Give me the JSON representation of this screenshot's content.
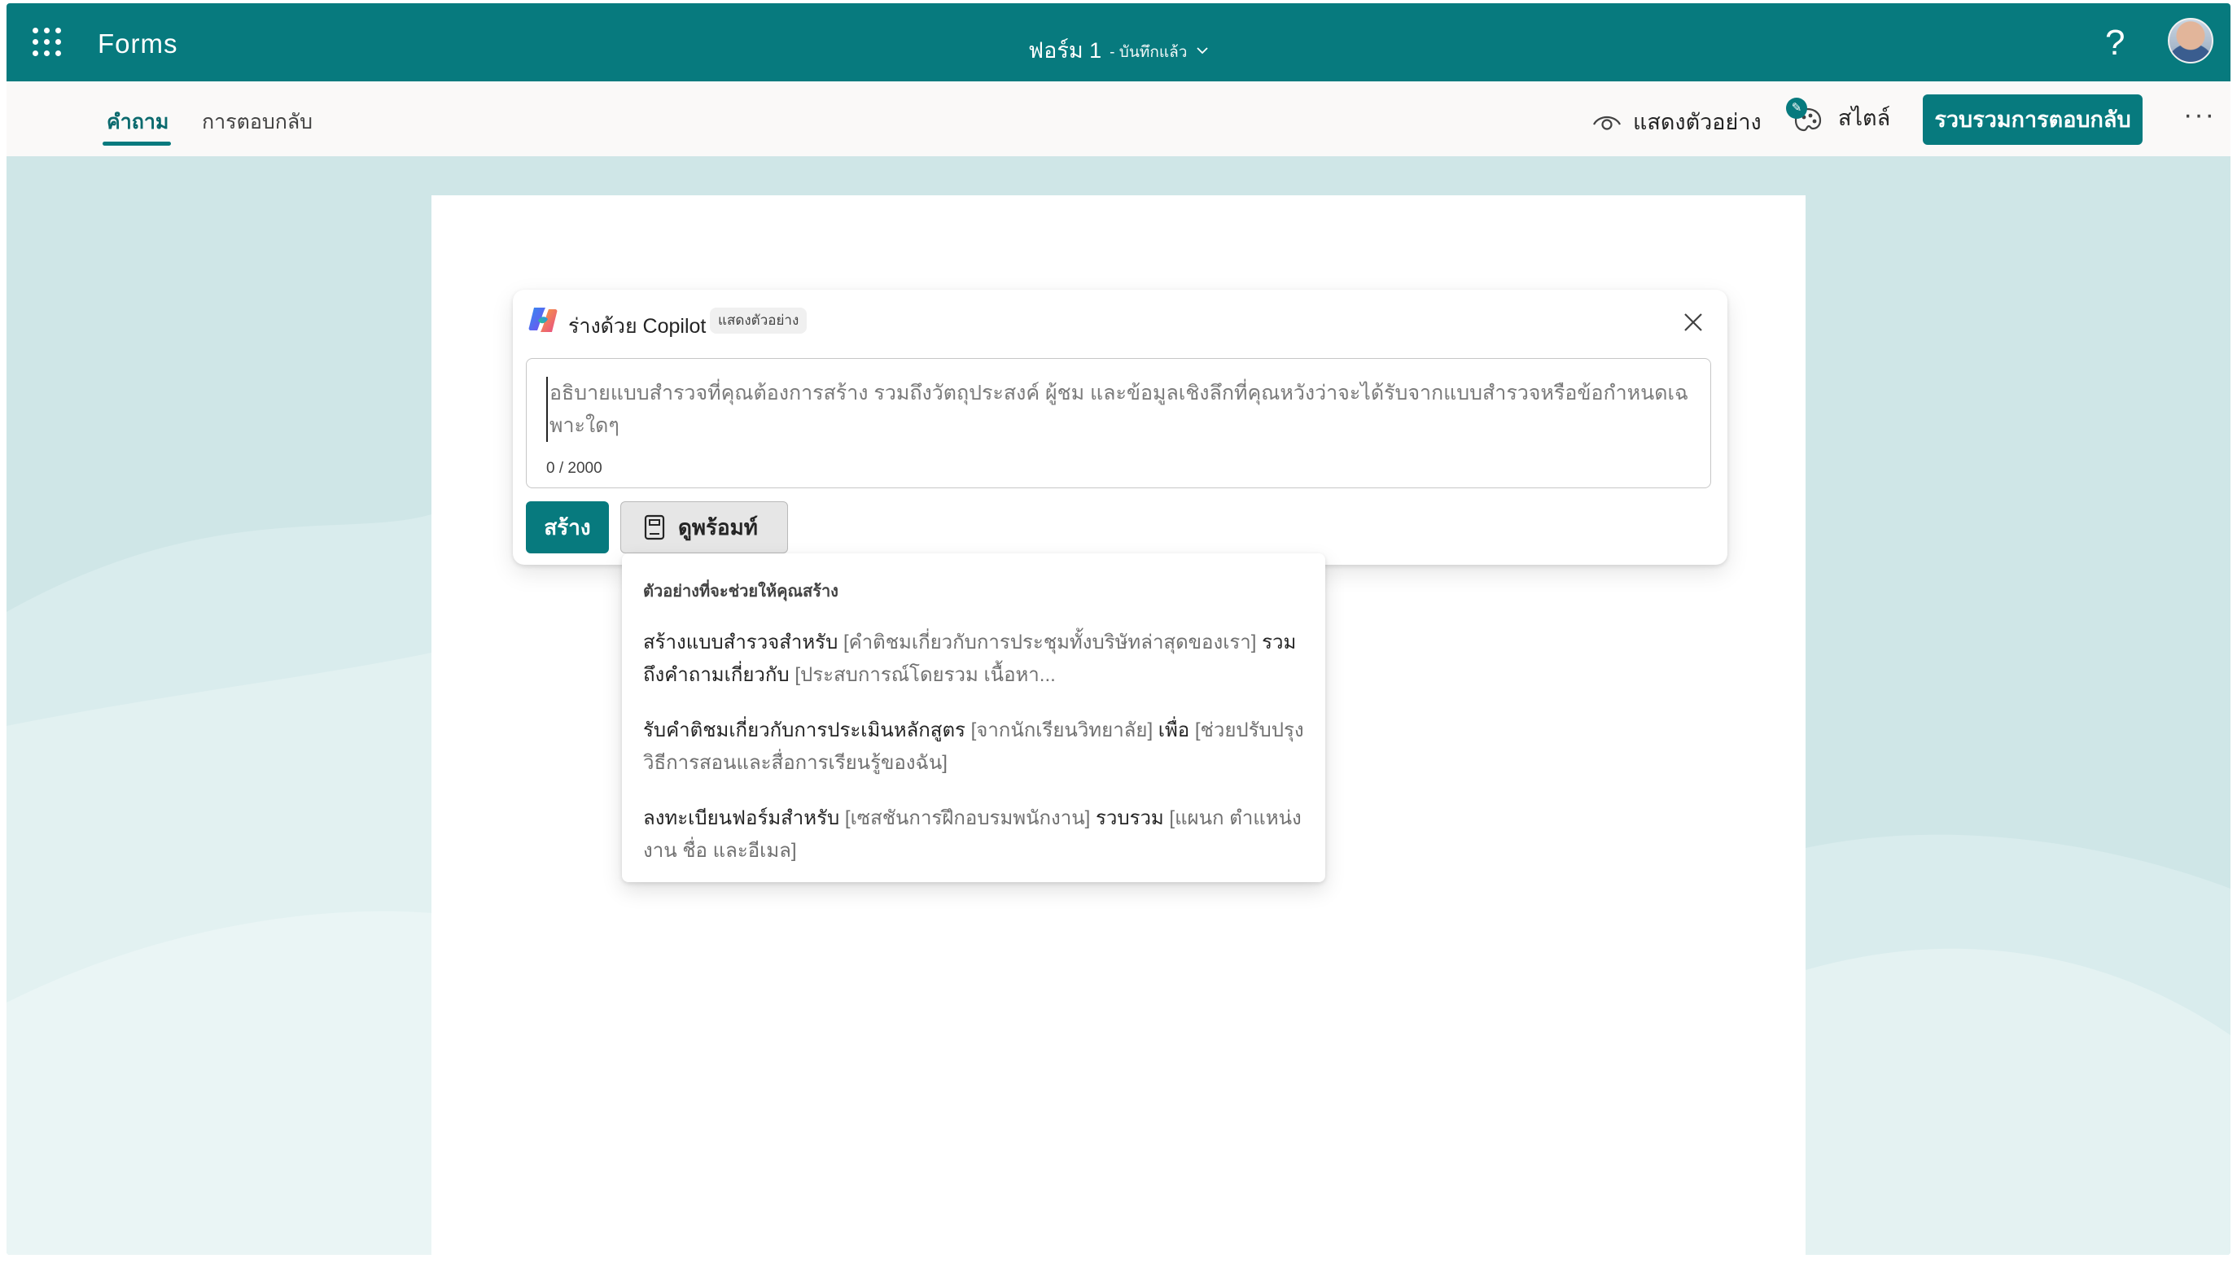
{
  "app": {
    "name": "Forms",
    "form_title": "ฟอร์ม 1",
    "save_status": "- บันทึกแล้ว",
    "help_label": "?",
    "brand_color": "#077a7e"
  },
  "commandbar": {
    "tabs": [
      {
        "label": "คำถาม",
        "active": true
      },
      {
        "label": "การตอบกลับ",
        "active": false
      }
    ],
    "preview_label": "แสดงตัวอย่าง",
    "style_label": "สไตล์",
    "collect_label": "รวบรวมการตอบกลับ",
    "more_label": "···"
  },
  "copilot": {
    "title": "ร่างด้วย Copilot",
    "badge": "แสดงตัวอย่าง",
    "placeholder": "อธิบายแบบสำรวจที่คุณต้องการสร้าง รวมถึงวัตถุประสงค์ ผู้ชม และข้อมูลเชิงลึกที่คุณหวังว่าจะได้รับจากแบบสำรวจหรือข้อกำหนดเฉพาะใดๆ",
    "char_count": "0 / 2000",
    "create_label": "สร้าง",
    "prompts_label": "ดูพร้อมท์"
  },
  "prompt_menu": {
    "heading": "ตัวอย่างที่จะช่วยให้คุณสร้าง",
    "items": [
      {
        "t1": "สร้างแบบสำรวจสำหรับ ",
        "p1": "[คำติชมเกี่ยวกับการประชุมทั้งบริษัทล่าสุดของเรา]",
        "t2": " รวมถึงคำถามเกี่ยวกับ ",
        "p2": "[ประสบการณ์โดยรวม เนื้อหา..."
      },
      {
        "t1": "รับคำติชมเกี่ยวกับการประเมินหลักสูตร ",
        "p1": "[จากนักเรียนวิทยาลัย]",
        "t2": " เพื่อ ",
        "p2": "[ช่วยปรับปรุงวิธีการสอนและสื่อการเรียนรู้ของฉัน]"
      },
      {
        "t1": "ลงทะเบียนฟอร์มสำหรับ ",
        "p1": "[เซสชันการฝึกอบรมพนักงาน]",
        "t2": " รวบรวม ",
        "p2": "[แผนก ตำแหน่งงาน ชื่อ และอีเมล]"
      }
    ]
  },
  "icons": {
    "waffle": "app-launcher-icon",
    "chevron": "chevron-down-icon",
    "preview": "eye-icon",
    "style": "palette-icon",
    "close": "close-icon",
    "prompts": "prompt-book-icon",
    "copilot": "copilot-logo-icon"
  }
}
